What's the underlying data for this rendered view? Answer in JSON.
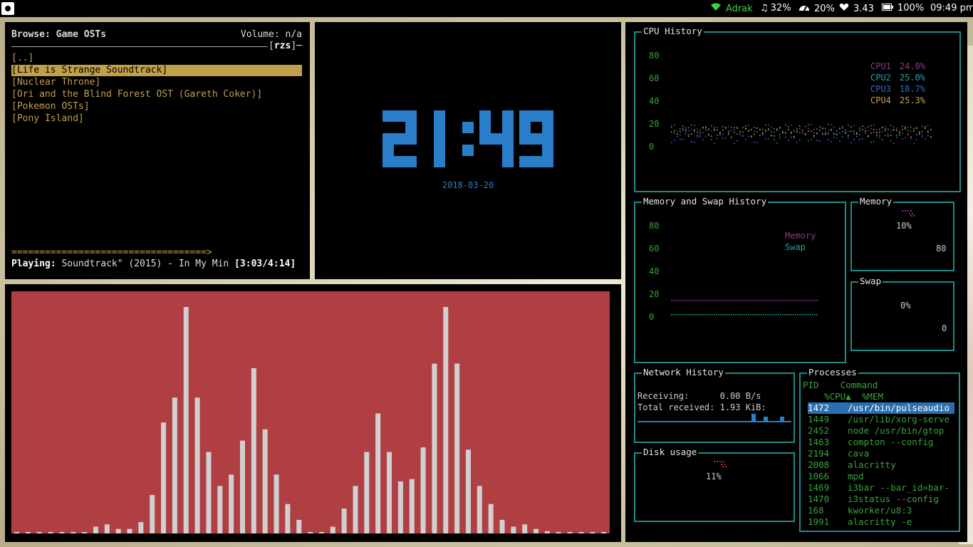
{
  "topbar": {
    "wifi": "Adrak",
    "volume": "32%",
    "cpu": "20%",
    "load": "3.43",
    "battery": "100%",
    "time": "09:49 pm",
    "icons": [
      "logo-icon",
      "wifi-icon",
      "music-note-icon",
      "gauge-icon",
      "heart-icon",
      "battery-icon"
    ]
  },
  "ncmpcpp": {
    "header": "Browse: Game OSTs",
    "volume": "Volume: n/a",
    "tag": "rzs",
    "items": [
      "[..]",
      "[Life is Strange Soundtrack]",
      "[Nuclear Throne]",
      "[Ori and the Blind Forest OST (Gareth Coker)]",
      "[Pokemon OSTs]",
      "[Pony Island]"
    ],
    "selected_index": 1,
    "progress": "===================================>",
    "playing_label": "Playing:",
    "playing_title": "Soundtrack\" (2015) - In My Min",
    "playing_time": "[3:03/4:14]"
  },
  "clock": {
    "time": "21:49",
    "date": "2018-03-20",
    "color": "#2a7dc9"
  },
  "cava": {
    "background": "#b03f44",
    "bar_color": "#d0d0d0",
    "levels": [
      0,
      0,
      0,
      0,
      0,
      0,
      0,
      3,
      4,
      2,
      2,
      5,
      17,
      49,
      60,
      100,
      60,
      36,
      21,
      26,
      41,
      73,
      46,
      26,
      13,
      6,
      0,
      0,
      3,
      11,
      21,
      36,
      53,
      36,
      23,
      24,
      38,
      75,
      100,
      75,
      37,
      21,
      13,
      6,
      3,
      4,
      2,
      1,
      0,
      0,
      0,
      0,
      0
    ]
  },
  "gtop": {
    "cpu": {
      "title": "CPU History",
      "yticks": [
        "80",
        "60",
        "40",
        "20",
        "0"
      ],
      "legend": [
        {
          "label": "CPU1",
          "value": "24.0%",
          "color": "#8a3a8a"
        },
        {
          "label": "CPU2",
          "value": "25.0%",
          "color": "#2aa0a0"
        },
        {
          "label": "CPU3",
          "value": "18.7%",
          "color": "#2a6fd0"
        },
        {
          "label": "CPU4",
          "value": "25.3%",
          "color": "#c9a040"
        }
      ]
    },
    "memswap": {
      "title": "Memory and Swap History",
      "yticks": [
        "80",
        "60",
        "40",
        "20",
        "0"
      ],
      "legend": [
        {
          "label": "Memory",
          "color": "#8a3a8a",
          "value": 10
        },
        {
          "label": "Swap",
          "color": "#2aa0a0",
          "value": 0
        }
      ]
    },
    "memory": {
      "title": "Memory",
      "percent": "10%",
      "tick": "80"
    },
    "swap": {
      "title": "Swap",
      "percent": "0%",
      "tick": "0"
    },
    "network": {
      "title": "Network History",
      "receiving_label": "Receiving:",
      "receiving_value": "0.00 B/s",
      "total_label": "Total received:",
      "total_value": "1.93 KiB:"
    },
    "disk": {
      "title": "Disk usage",
      "percent": "11%"
    },
    "processes": {
      "title": "Processes",
      "col_pid": "PID",
      "col_cmd": "Command",
      "col_cpu": "%CPU▲",
      "col_mem": "%MEM",
      "rows": [
        {
          "pid": "1472",
          "cmd": "/usr/bin/pulseaudio"
        },
        {
          "pid": "1449",
          "cmd": "/usr/lib/xorg-serve"
        },
        {
          "pid": "2452",
          "cmd": "node /usr/bin/gtop"
        },
        {
          "pid": "1463",
          "cmd": "compton --config"
        },
        {
          "pid": "2194",
          "cmd": "cava"
        },
        {
          "pid": "2008",
          "cmd": "alacritty"
        },
        {
          "pid": "1066",
          "cmd": "mpd"
        },
        {
          "pid": "1469",
          "cmd": "i3bar --bar_id=bar-"
        },
        {
          "pid": "1470",
          "cmd": "i3status --config"
        },
        {
          "pid": "168",
          "cmd": "kworker/u8:3"
        },
        {
          "pid": "1991",
          "cmd": "alacritty -e"
        }
      ]
    }
  }
}
